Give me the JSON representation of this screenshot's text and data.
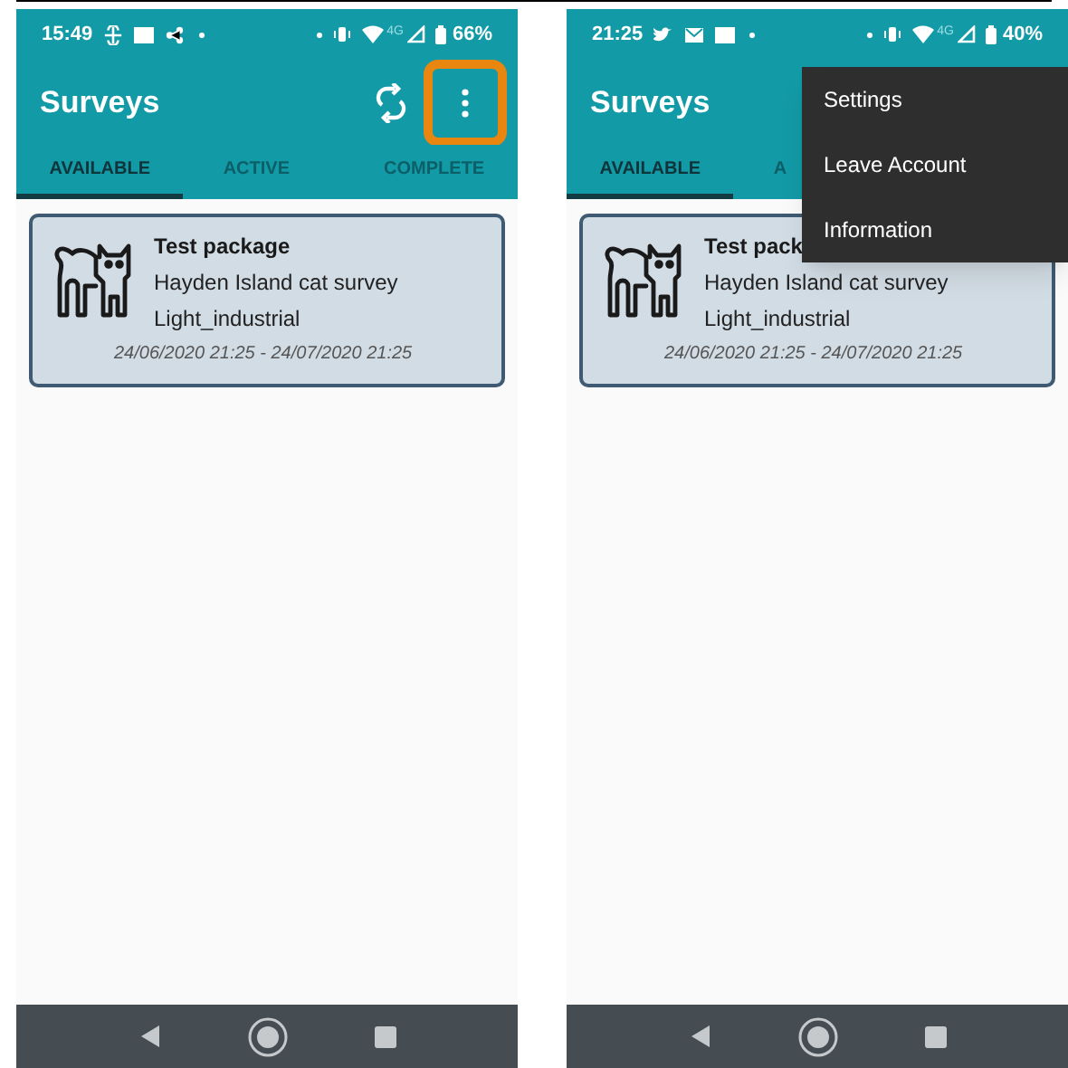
{
  "screens": [
    {
      "status_bar": {
        "time": "15:49",
        "network": "4G",
        "battery": "66%"
      },
      "app_bar": {
        "title": "Surveys",
        "more_highlighted": true
      },
      "tabs": [
        {
          "label": "AVAILABLE",
          "selected": true
        },
        {
          "label": "ACTIVE",
          "selected": false
        },
        {
          "label": "COMPLETE",
          "selected": false
        }
      ],
      "cards": [
        {
          "title": "Test package",
          "survey": "Hayden Island cat survey",
          "category": "Light_industrial",
          "dates": "24/06/2020 21:25 - 24/07/2020 21:25"
        }
      ]
    },
    {
      "status_bar": {
        "time": "21:25",
        "network": "4G",
        "battery": "40%"
      },
      "app_bar": {
        "title": "Surveys"
      },
      "tabs": [
        {
          "label": "AVAILABLE",
          "selected": true
        },
        {
          "label": "A",
          "selected": false
        }
      ],
      "cards": [
        {
          "title": "Test pack",
          "survey": "Hayden Island cat survey",
          "category": "Light_industrial",
          "dates": "24/06/2020 21:25 - 24/07/2020 21:25"
        }
      ],
      "menu": [
        {
          "label": "Settings"
        },
        {
          "label": "Leave Account"
        },
        {
          "label": "Information"
        }
      ]
    }
  ]
}
